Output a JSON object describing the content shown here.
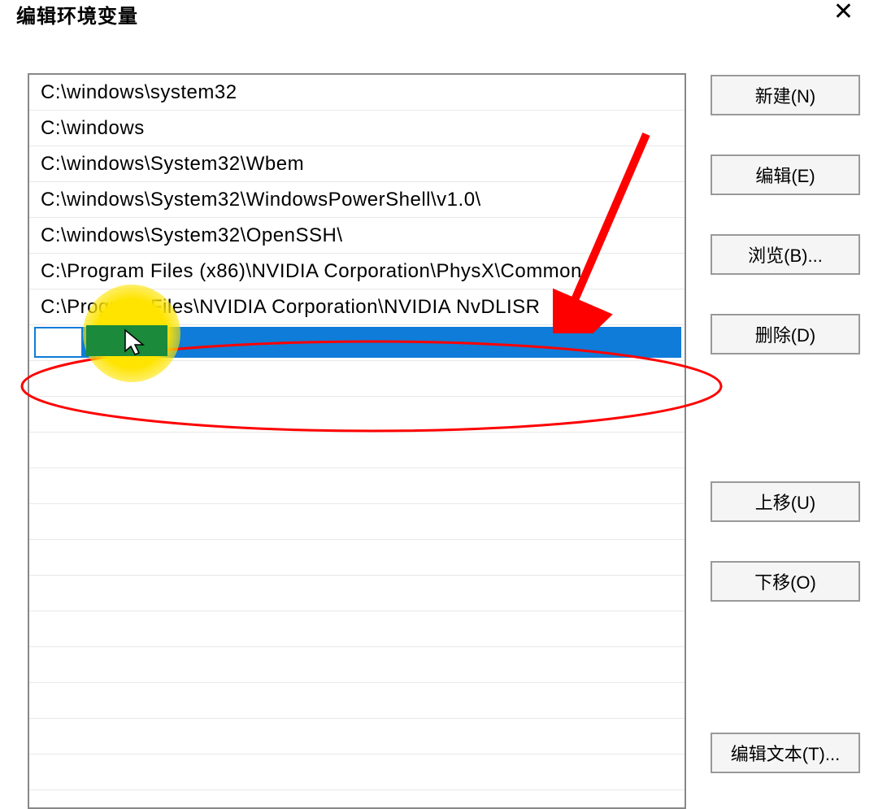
{
  "window": {
    "title": "编辑环境变量",
    "close_symbol": "✕"
  },
  "list": {
    "items": [
      "C:\\windows\\system32",
      "C:\\windows",
      "C:\\windows\\System32\\Wbem",
      "C:\\windows\\System32\\WindowsPowerShell\\v1.0\\",
      "C:\\windows\\System32\\OpenSSH\\",
      "C:\\Program Files (x86)\\NVIDIA Corporation\\PhysX\\Common",
      "C:\\Program Files\\NVIDIA Corporation\\NVIDIA NvDLISR"
    ],
    "editing_value": ""
  },
  "buttons": {
    "new": "新建(N)",
    "edit": "编辑(E)",
    "browse": "浏览(B)...",
    "delete": "删除(D)",
    "move_up": "上移(U)",
    "move_down": "下移(O)",
    "edit_text": "编辑文本(T)..."
  },
  "annotations": {
    "highlight_color": "#ffe400",
    "arrow_color": "#ff0000",
    "ellipse_color": "#ff0000"
  }
}
